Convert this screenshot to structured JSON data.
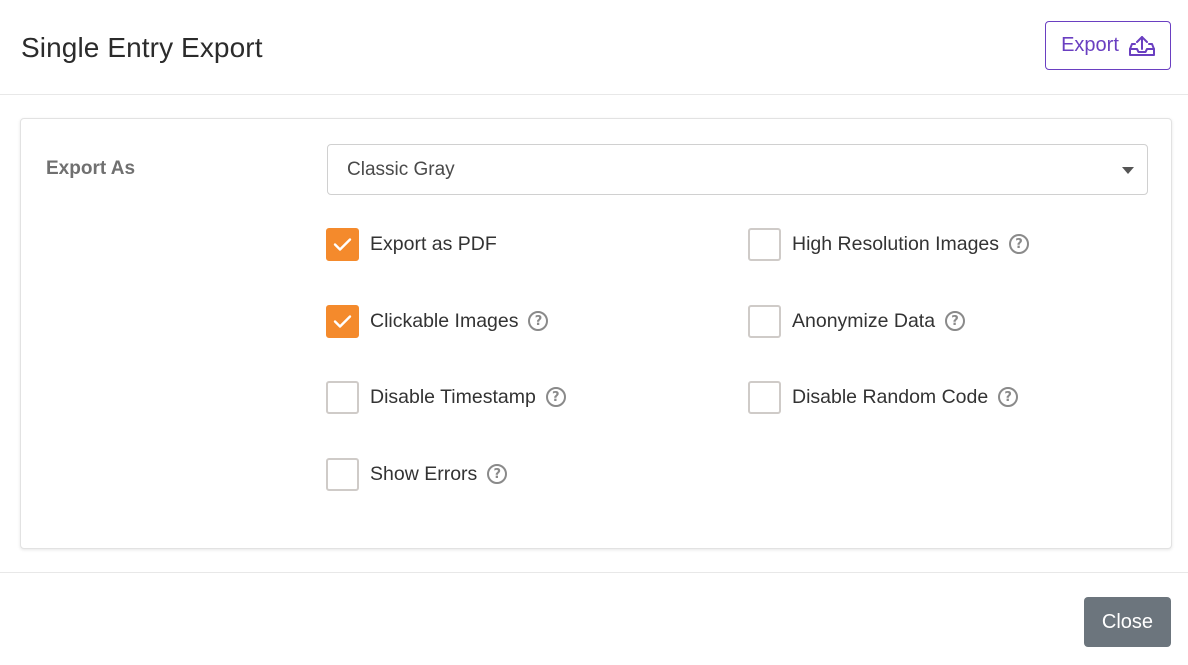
{
  "header": {
    "title": "Single Entry Export",
    "export_label": "Export"
  },
  "form": {
    "export_as_label": "Export As",
    "export_as_value": "Classic Gray"
  },
  "options": [
    {
      "label": "Export as PDF",
      "checked": true,
      "help": false
    },
    {
      "label": "High Resolution Images",
      "checked": false,
      "help": true
    },
    {
      "label": "Clickable Images",
      "checked": true,
      "help": true
    },
    {
      "label": "Anonymize Data",
      "checked": false,
      "help": true
    },
    {
      "label": "Disable Timestamp",
      "checked": false,
      "help": true
    },
    {
      "label": "Disable Random Code",
      "checked": false,
      "help": true
    },
    {
      "label": "Show Errors",
      "checked": false,
      "help": true
    }
  ],
  "help_glyph": "?",
  "footer": {
    "close_label": "Close"
  },
  "colors": {
    "accent_purple": "#6a3fc1",
    "checkbox_checked": "#f48a2c",
    "close_button": "#6c757d"
  },
  "icons": {
    "export": "upload-tray-icon",
    "dropdown": "caret-down-icon",
    "help": "question-circle-icon",
    "check": "checkmark-icon"
  }
}
